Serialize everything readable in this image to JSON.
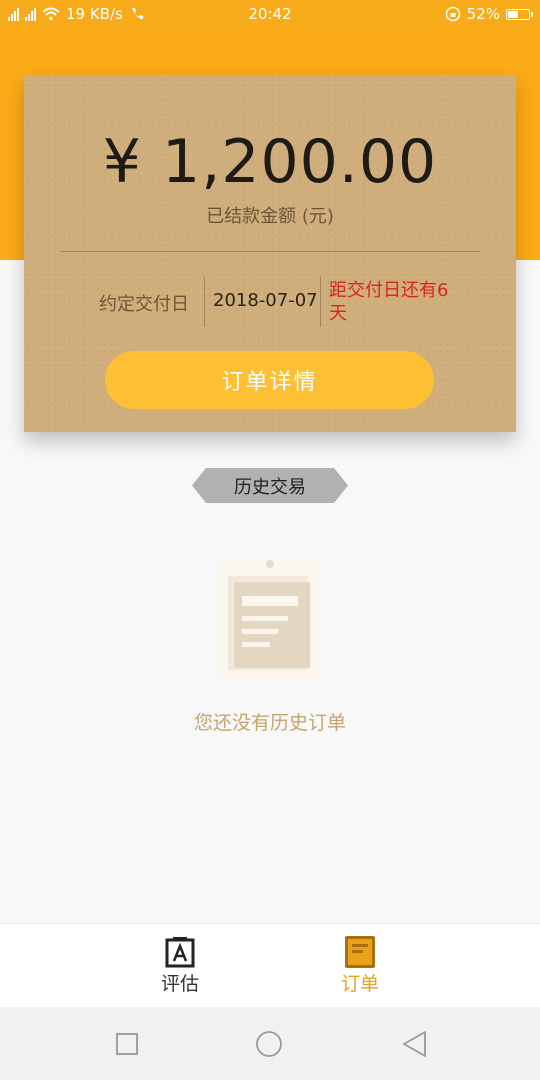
{
  "status_bar": {
    "network_left": "4G",
    "network_right": "2G",
    "speed": "19 KB/s",
    "call_badge": "HD",
    "time": "20:42",
    "battery": "52%",
    "battery_level": 0.52
  },
  "card": {
    "amount": "¥ 1,200.00",
    "amount_label": "已结款金额 (元)",
    "delivery_label": "约定交付日",
    "delivery_date": "2018-07-07",
    "remaining": "距交付日还有6天",
    "order_button": "订单详情"
  },
  "history": {
    "tag": "历史交易",
    "empty_text": "您还没有历史订单",
    "empty_icon": "clipboard-icon"
  },
  "tabs": [
    {
      "label": "评估",
      "icon": "assess-icon",
      "active": false
    },
    {
      "label": "订单",
      "icon": "order-icon",
      "active": true
    }
  ],
  "colors": {
    "accent": "#fbab18",
    "card": "#cfae7b",
    "button": "#fdbf33",
    "warning": "#d8261c",
    "active_tab": "#e9a21a"
  },
  "nav": [
    "recent-apps-icon",
    "home-icon",
    "back-icon"
  ]
}
